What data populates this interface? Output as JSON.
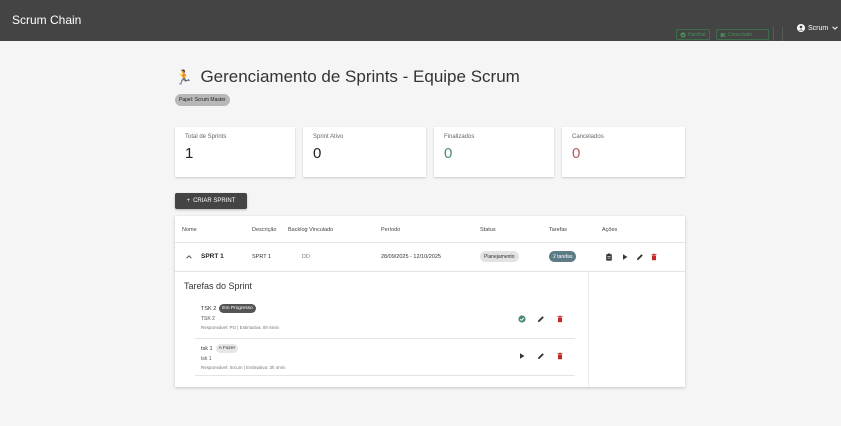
{
  "app": {
    "title": "Scrum Chain"
  },
  "header": {
    "hardhat_label": "Hardhat",
    "wallet_label": "Conectado",
    "user_label": "Scrum"
  },
  "page": {
    "title": "Gerenciamento de Sprints - Equipe Scrum",
    "role": "Papel: Scrum Master"
  },
  "stats": [
    {
      "label": "Total de Sprints",
      "value": "1"
    },
    {
      "label": "Sprint Ativo",
      "value": "0"
    },
    {
      "label": "Finalizados",
      "value": "0"
    },
    {
      "label": "Cancelados",
      "value": "0"
    }
  ],
  "create_button": "CRIAR SPRINT",
  "table": {
    "headers": [
      "Nome",
      "Descrição",
      "Backlog Vinculado",
      "Período",
      "Status",
      "Tarefas",
      "Ações"
    ],
    "row": {
      "name": "SPRT 1",
      "description": "SPRT 1",
      "backlog": "DD",
      "period": "28/09/2025 - 12/10/2025",
      "status": "Planejamento",
      "tasks": "2 tarefas"
    }
  },
  "sprint_tasks": {
    "title": "Tarefas do Sprint",
    "items": [
      {
        "name": "TSK 2",
        "status": "Em Progresso",
        "description": "TSK 2",
        "meta": "Responsável: PO | Estimativa: 8h 6min"
      },
      {
        "name": "tsk 1",
        "status": "A Fazer",
        "description": "tsk 1",
        "meta": "Responsável: Srcum | Estimativa: 3h 4min"
      }
    ]
  },
  "colors": {
    "topbar": "#444444",
    "accent_green": "#4e8a70",
    "accent_red": "#b05a5a",
    "delete_red": "#c62828",
    "tasks_badge": "#5d7b85"
  }
}
